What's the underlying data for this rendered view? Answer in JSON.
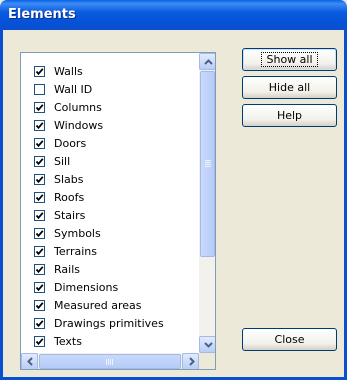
{
  "window": {
    "title": "Elements"
  },
  "list": {
    "items": [
      {
        "label": "Walls",
        "checked": true
      },
      {
        "label": "Wall ID",
        "checked": false
      },
      {
        "label": "Columns",
        "checked": true
      },
      {
        "label": "Windows",
        "checked": true
      },
      {
        "label": "Doors",
        "checked": true
      },
      {
        "label": "Sill",
        "checked": true
      },
      {
        "label": "Slabs",
        "checked": true
      },
      {
        "label": "Roofs",
        "checked": true
      },
      {
        "label": "Stairs",
        "checked": true
      },
      {
        "label": "Symbols",
        "checked": true
      },
      {
        "label": "Terrains",
        "checked": true
      },
      {
        "label": "Rails",
        "checked": true
      },
      {
        "label": "Dimensions",
        "checked": true
      },
      {
        "label": "Measured areas",
        "checked": true
      },
      {
        "label": "Drawings primitives",
        "checked": true
      },
      {
        "label": "Texts",
        "checked": true
      }
    ]
  },
  "buttons": {
    "show_all": "Show all",
    "hide_all": "Hide all",
    "help": "Help",
    "close": "Close"
  },
  "icons": {
    "scroll_up": "chevron-up-icon",
    "scroll_down": "chevron-down-icon",
    "scroll_left": "chevron-left-icon",
    "scroll_right": "chevron-right-icon",
    "check": "checkmark-icon"
  }
}
